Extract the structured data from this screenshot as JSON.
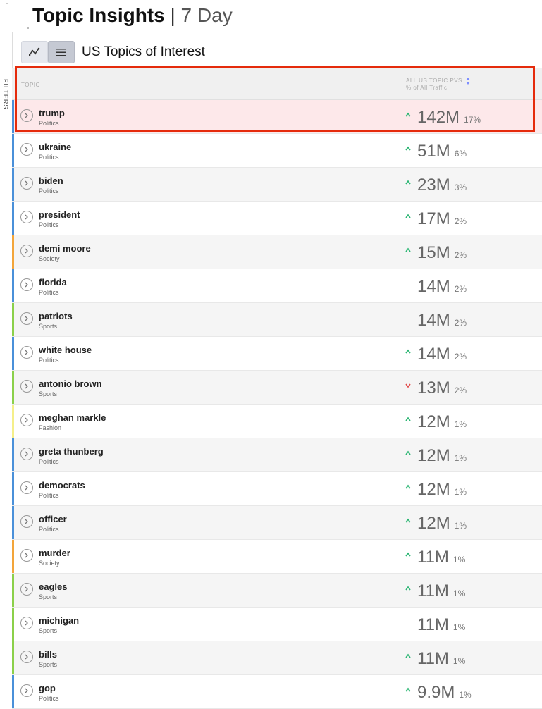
{
  "header": {
    "title": "Topic Insights",
    "separator": "|",
    "period": "7 Day"
  },
  "sidebar": {
    "filters_label": "FILTERS"
  },
  "toolbar": {
    "chart_view_icon": "line-chart-icon",
    "list_view_icon": "list-icon",
    "active_view": "list"
  },
  "section": {
    "title": "US Topics of Interest"
  },
  "table": {
    "columns": {
      "topic": "TOPIC",
      "metric": "ALL US TOPIC PVS",
      "metric_sub": "% of All Traffic"
    },
    "rows": [
      {
        "topic": "trump",
        "category": "Politics",
        "value": "142M",
        "pct": "17%",
        "trend": "up",
        "accent": "#4a90d9",
        "highlighted": true
      },
      {
        "topic": "ukraine",
        "category": "Politics",
        "value": "51M",
        "pct": "6%",
        "trend": "up",
        "accent": "#4a90d9"
      },
      {
        "topic": "biden",
        "category": "Politics",
        "value": "23M",
        "pct": "3%",
        "trend": "up",
        "accent": "#4a90d9"
      },
      {
        "topic": "president",
        "category": "Politics",
        "value": "17M",
        "pct": "2%",
        "trend": "up",
        "accent": "#4a90d9"
      },
      {
        "topic": "demi moore",
        "category": "Society",
        "value": "15M",
        "pct": "2%",
        "trend": "up",
        "accent": "#f3a53a"
      },
      {
        "topic": "florida",
        "category": "Politics",
        "value": "14M",
        "pct": "2%",
        "trend": "none",
        "accent": "#4a90d9"
      },
      {
        "topic": "patriots",
        "category": "Sports",
        "value": "14M",
        "pct": "2%",
        "trend": "none",
        "accent": "#8bd04a"
      },
      {
        "topic": "white house",
        "category": "Politics",
        "value": "14M",
        "pct": "2%",
        "trend": "up",
        "accent": "#4a90d9"
      },
      {
        "topic": "antonio brown",
        "category": "Sports",
        "value": "13M",
        "pct": "2%",
        "trend": "down",
        "accent": "#8bd04a"
      },
      {
        "topic": "meghan markle",
        "category": "Fashion",
        "value": "12M",
        "pct": "1%",
        "trend": "up",
        "accent": "#f5ef8a"
      },
      {
        "topic": "greta thunberg",
        "category": "Politics",
        "value": "12M",
        "pct": "1%",
        "trend": "up",
        "accent": "#4a90d9"
      },
      {
        "topic": "democrats",
        "category": "Politics",
        "value": "12M",
        "pct": "1%",
        "trend": "up",
        "accent": "#4a90d9"
      },
      {
        "topic": "officer",
        "category": "Politics",
        "value": "12M",
        "pct": "1%",
        "trend": "up",
        "accent": "#4a90d9"
      },
      {
        "topic": "murder",
        "category": "Society",
        "value": "11M",
        "pct": "1%",
        "trend": "up",
        "accent": "#f3a53a"
      },
      {
        "topic": "eagles",
        "category": "Sports",
        "value": "11M",
        "pct": "1%",
        "trend": "up",
        "accent": "#8bd04a"
      },
      {
        "topic": "michigan",
        "category": "Sports",
        "value": "11M",
        "pct": "1%",
        "trend": "none",
        "accent": "#8bd04a"
      },
      {
        "topic": "bills",
        "category": "Sports",
        "value": "11M",
        "pct": "1%",
        "trend": "up",
        "accent": "#8bd04a"
      },
      {
        "topic": "gop",
        "category": "Politics",
        "value": "9.9M",
        "pct": "1%",
        "trend": "up",
        "accent": "#4a90d9"
      }
    ]
  },
  "colors": {
    "highlight_border": "#e52b0c",
    "highlight_row_bg": "#fde8ea",
    "trend_up": "#2bb673",
    "trend_down": "#e24a4a",
    "row_alt_bg": "#f5f5f5",
    "filters_handle": "#1a73e8"
  }
}
